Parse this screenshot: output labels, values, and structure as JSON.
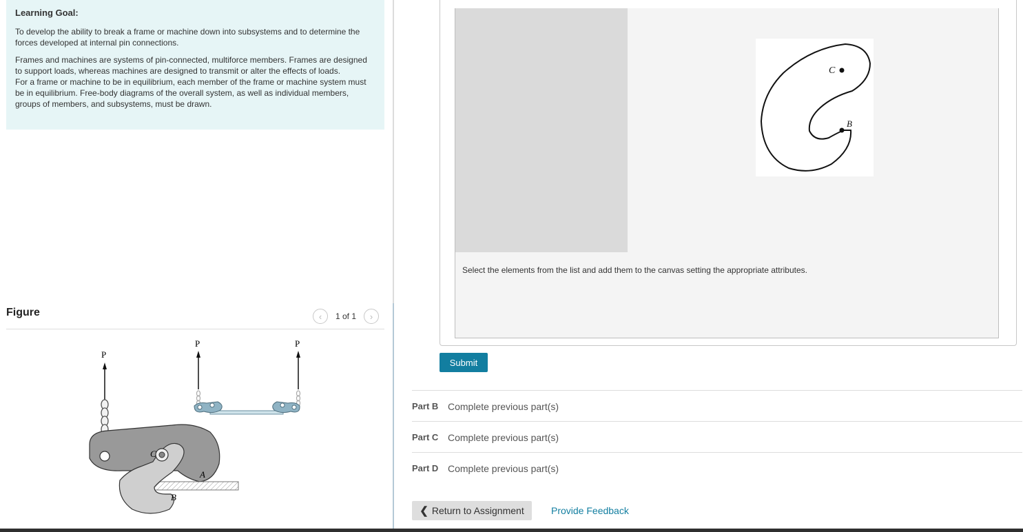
{
  "learning_goal": {
    "title": "Learning Goal:",
    "p1": "To develop the ability to break a frame or machine down into subsystems and to determine the forces developed at internal pin connections.",
    "p2": "Frames and machines are systems of pin-connected, multiforce members. Frames are designed to support loads, whereas machines are designed to transmit or alter the effects of loads.",
    "p3": "For a frame or machine to be in equilibrium, each member of the frame or machine system must be in equilibrium. Free-body diagrams of the overall system, as well as individual members, groups of members, and subsystems, must be drawn."
  },
  "figure": {
    "title": "Figure",
    "pager": "1 of 1",
    "labels": {
      "p": "P",
      "a": "A",
      "b": "B",
      "c": "C"
    }
  },
  "canvas": {
    "hook_labels": {
      "c": "C",
      "b": "B"
    },
    "instructions": "Select the elements from the list and add them to the canvas setting the appropriate attributes."
  },
  "submit_label": "Submit",
  "parts": [
    {
      "label": "Part B",
      "status": "Complete previous part(s)"
    },
    {
      "label": "Part C",
      "status": "Complete previous part(s)"
    },
    {
      "label": "Part D",
      "status": "Complete previous part(s)"
    }
  ],
  "footer": {
    "return_label": "Return to Assignment",
    "feedback_label": "Provide Feedback"
  },
  "colors": {
    "accent": "#127ea0",
    "goal_background": "#e6f5f6"
  }
}
